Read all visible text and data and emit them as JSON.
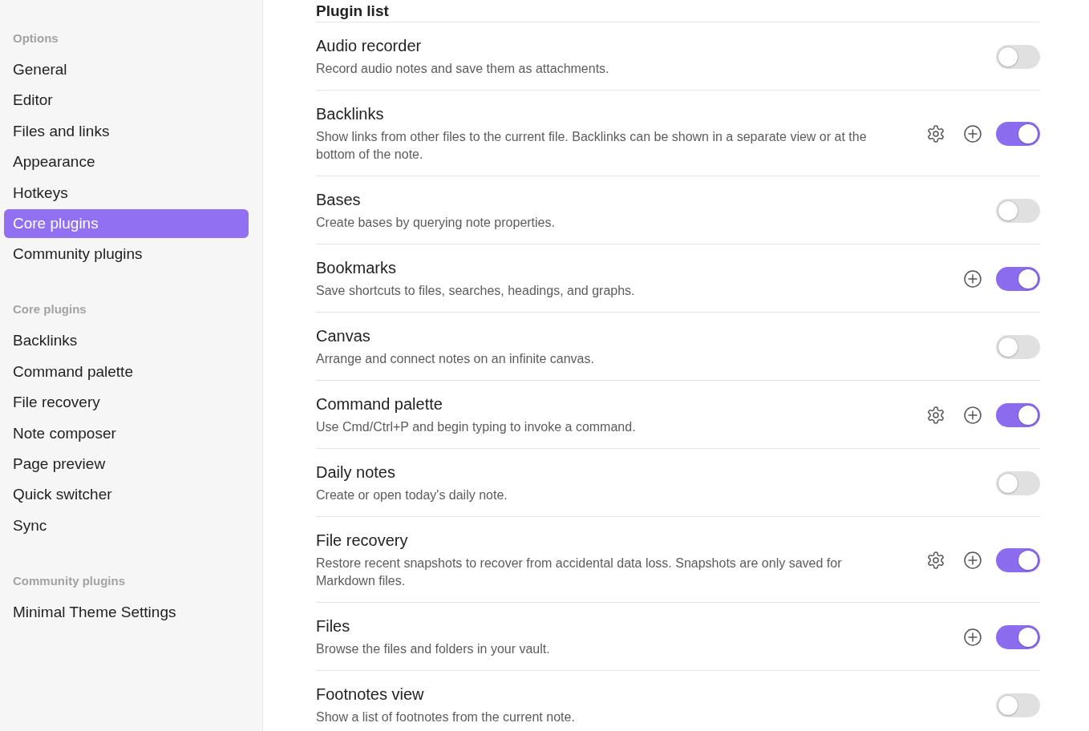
{
  "sidebar": {
    "sections": [
      {
        "heading": "Options",
        "items": [
          {
            "label": "General",
            "selected": false
          },
          {
            "label": "Editor",
            "selected": false
          },
          {
            "label": "Files and links",
            "selected": false
          },
          {
            "label": "Appearance",
            "selected": false
          },
          {
            "label": "Hotkeys",
            "selected": false
          },
          {
            "label": "Core plugins",
            "selected": true
          },
          {
            "label": "Community plugins",
            "selected": false
          }
        ]
      },
      {
        "heading": "Core plugins",
        "items": [
          {
            "label": "Backlinks",
            "selected": false
          },
          {
            "label": "Command palette",
            "selected": false
          },
          {
            "label": "File recovery",
            "selected": false
          },
          {
            "label": "Note composer",
            "selected": false
          },
          {
            "label": "Page preview",
            "selected": false
          },
          {
            "label": "Quick switcher",
            "selected": false
          },
          {
            "label": "Sync",
            "selected": false
          }
        ]
      },
      {
        "heading": "Community plugins",
        "items": [
          {
            "label": "Minimal Theme Settings",
            "selected": false
          }
        ]
      }
    ]
  },
  "main": {
    "heading": "Plugin list",
    "plugins": [
      {
        "name": "Audio recorder",
        "description": "Record audio notes and save them as attachments.",
        "settings": false,
        "hotkeys": false,
        "enabled": false
      },
      {
        "name": "Backlinks",
        "description": "Show links from other files to the current file. Backlinks can be shown in a separate view or at the bottom of the note.",
        "settings": true,
        "hotkeys": true,
        "enabled": true
      },
      {
        "name": "Bases",
        "description": "Create bases by querying note properties.",
        "settings": false,
        "hotkeys": false,
        "enabled": false
      },
      {
        "name": "Bookmarks",
        "description": "Save shortcuts to files, searches, headings, and graphs.",
        "settings": false,
        "hotkeys": true,
        "enabled": true
      },
      {
        "name": "Canvas",
        "description": "Arrange and connect notes on an infinite canvas.",
        "settings": false,
        "hotkeys": false,
        "enabled": false
      },
      {
        "name": "Command palette",
        "description": "Use Cmd/Ctrl+P and begin typing to invoke a command.",
        "settings": true,
        "hotkeys": true,
        "enabled": true
      },
      {
        "name": "Daily notes",
        "description": "Create or open today's daily note.",
        "settings": false,
        "hotkeys": false,
        "enabled": false
      },
      {
        "name": "File recovery",
        "description": "Restore recent snapshots to recover from accidental data loss. Snapshots are only saved for Markdown files.",
        "settings": true,
        "hotkeys": true,
        "enabled": true
      },
      {
        "name": "Files",
        "description": "Browse the files and folders in your vault.",
        "settings": false,
        "hotkeys": true,
        "enabled": true
      },
      {
        "name": "Footnotes view",
        "description": "Show a list of footnotes from the current note.",
        "settings": false,
        "hotkeys": false,
        "enabled": false
      }
    ]
  }
}
